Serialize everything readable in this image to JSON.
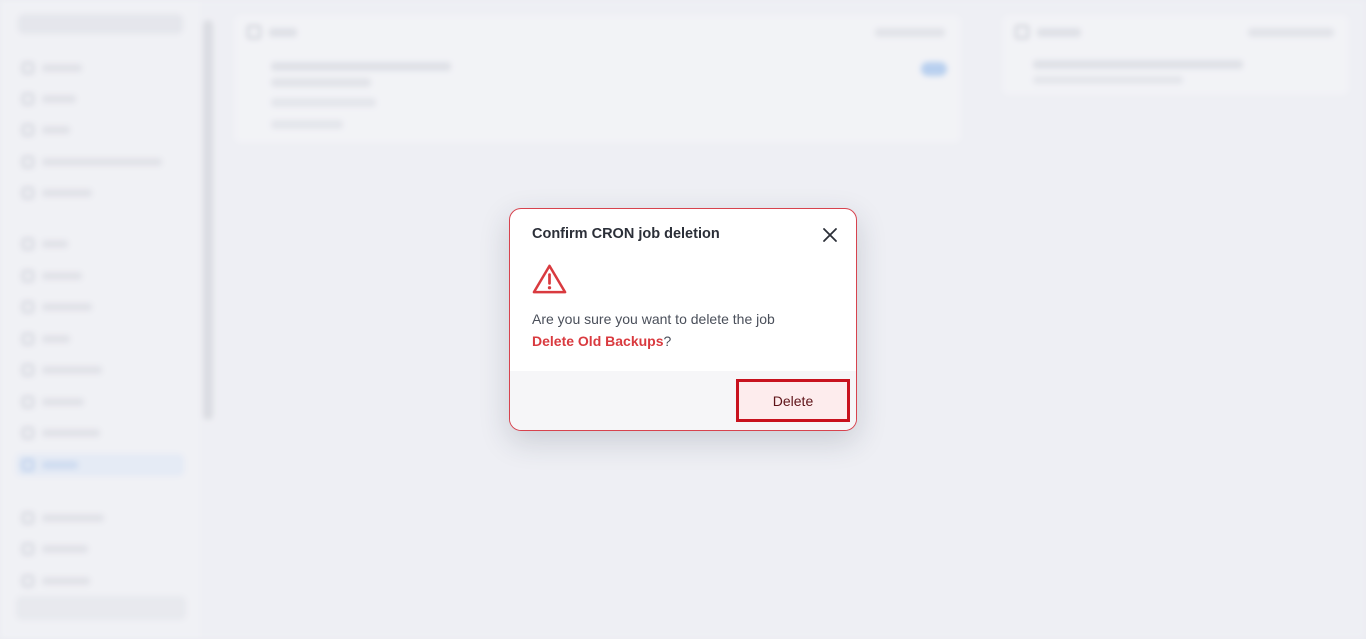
{
  "dialog": {
    "title": "Confirm CRON job deletion",
    "close_icon": "close-icon",
    "warning_icon": "warning-triangle-icon",
    "message_prefix": "Are you sure you want to delete the job",
    "job_name": "Delete Old Backups",
    "message_suffix": "?",
    "delete_label": "Delete"
  },
  "colors": {
    "danger": "#d93a3f",
    "modal_border": "#d7434e",
    "delete_button_border": "#c8121e",
    "delete_button_bg": "#fdeced"
  }
}
